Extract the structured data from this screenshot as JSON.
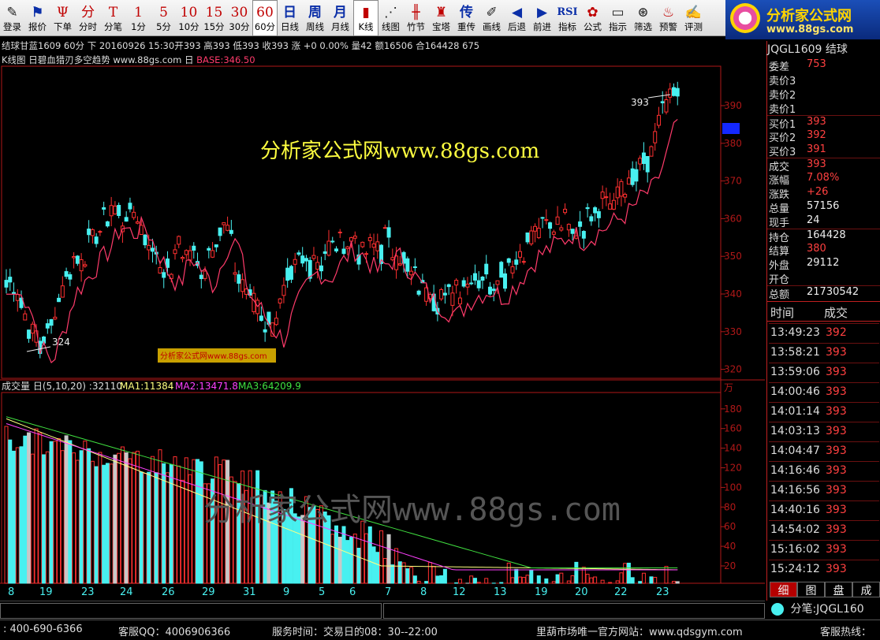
{
  "toolbar": [
    {
      "icon": "pencil-icon",
      "glyph": "✎",
      "label": "登录",
      "cls": "g"
    },
    {
      "icon": "quote-icon",
      "glyph": "⚑",
      "label": "报价",
      "cls": "b"
    },
    {
      "icon": "order-icon",
      "glyph": "Ψ",
      "label": "下单",
      "cls": ""
    },
    {
      "icon": "minute-icon",
      "glyph": "分",
      "label": "分时",
      "cls": ""
    },
    {
      "icon": "tick-icon",
      "glyph": "T",
      "label": "分笔",
      "cls": ""
    },
    {
      "icon": "1min-icon",
      "glyph": "1",
      "label": "1分",
      "cls": ""
    },
    {
      "icon": "5min-icon",
      "glyph": "5",
      "label": "5分",
      "cls": ""
    },
    {
      "icon": "10min-icon",
      "glyph": "10",
      "label": "10分",
      "cls": ""
    },
    {
      "icon": "15min-icon",
      "glyph": "15",
      "label": "15分",
      "cls": ""
    },
    {
      "icon": "30min-icon",
      "glyph": "30",
      "label": "30分",
      "cls": ""
    },
    {
      "icon": "60min-icon",
      "glyph": "60",
      "label": "60分",
      "cls": "",
      "on": true
    },
    {
      "icon": "day-icon",
      "glyph": "日",
      "label": "日线",
      "cls": "b"
    },
    {
      "icon": "week-icon",
      "glyph": "周",
      "label": "周线",
      "cls": "b"
    },
    {
      "icon": "month-icon",
      "glyph": "月",
      "label": "月线",
      "cls": "b"
    },
    {
      "icon": "kline-icon",
      "glyph": "▮",
      "label": "K线",
      "cls": "",
      "on": true
    },
    {
      "icon": "line-chart-icon",
      "glyph": "⋰",
      "label": "线图",
      "cls": "g"
    },
    {
      "icon": "bamboo-icon",
      "glyph": "╫",
      "label": "竹节",
      "cls": ""
    },
    {
      "icon": "tower-icon",
      "glyph": "♜",
      "label": "宝塔",
      "cls": ""
    },
    {
      "icon": "reload-icon",
      "glyph": "传",
      "label": "重传",
      "cls": "b"
    },
    {
      "icon": "draw-icon",
      "glyph": "✐",
      "label": "画线",
      "cls": "g"
    },
    {
      "icon": "back-icon",
      "glyph": "◀",
      "label": "后退",
      "cls": "b"
    },
    {
      "icon": "forward-icon",
      "glyph": "▶",
      "label": "前进",
      "cls": "b"
    },
    {
      "icon": "rsi-icon",
      "glyph": "RSI",
      "label": "指标",
      "cls": "b"
    },
    {
      "icon": "formula-icon",
      "glyph": "✿",
      "label": "公式",
      "cls": ""
    },
    {
      "icon": "indicator-icon",
      "glyph": "▭",
      "label": "指示",
      "cls": "g"
    },
    {
      "icon": "binoculars-icon",
      "glyph": "⊛",
      "label": "筛选",
      "cls": "g"
    },
    {
      "icon": "alarm-icon",
      "glyph": "♨",
      "label": "预警",
      "cls": ""
    },
    {
      "icon": "review-icon",
      "glyph": "✍",
      "label": "评测",
      "cls": "g"
    }
  ],
  "logo": {
    "title": "分析家公式网",
    "url": "www.88gs.com"
  },
  "header": {
    "info_line": "结球甘蓝1609 60分 下  20160926 15:30开393 高393 低393 收393 涨 +0 0.00% 量42 额16506 合164428 675",
    "chart_title": "K线图 日碧血猎刃多空趋势 www.88gs.com 日",
    "base_label": "BASE:346.50"
  },
  "watermark_main": "分析家公式网www.88gs.com",
  "watermark_small": "分析家公式网www.88gs.com",
  "watermark_volume": "分析家公式网www.88gs.com",
  "annot": {
    "high": "393",
    "low": "324"
  },
  "volume_header": {
    "name": "成交量 日(5,10,20) :32110",
    "ma1": "MA1:11384",
    "ma2": "MA2:13471.8",
    "ma3": "MA3:64209.9",
    "unit": "万"
  },
  "x_labels": [
    "8",
    "19",
    "23",
    "24",
    "26",
    "29",
    "31",
    "9",
    "5",
    "6",
    "7",
    "8",
    "12",
    "13",
    "19",
    "20",
    "22",
    "23"
  ],
  "price_axis": [
    "390",
    "380",
    "370",
    "360",
    "350",
    "340",
    "330",
    "320"
  ],
  "volume_axis": [
    "180",
    "160",
    "140",
    "120",
    "100",
    "80",
    "60",
    "40",
    "20"
  ],
  "side": {
    "code": "JQGL1609 结球",
    "rows": [
      {
        "k": "委差",
        "v": "753",
        "c": "red"
      },
      {
        "k": "卖价3",
        "v": "",
        "c": "wht"
      },
      {
        "k": "卖价2",
        "v": "",
        "c": "wht"
      },
      {
        "k": "卖价1",
        "v": "",
        "c": "wht"
      },
      {
        "k": "买价1",
        "v": "393",
        "c": "red"
      },
      {
        "k": "买价2",
        "v": "392",
        "c": "red"
      },
      {
        "k": "买价3",
        "v": "391",
        "c": "red"
      },
      {
        "k": "成交",
        "v": "393",
        "c": "red"
      },
      {
        "k": "涨幅",
        "v": "7.08%",
        "c": "red"
      },
      {
        "k": "涨跌",
        "v": "+26",
        "c": "red"
      },
      {
        "k": "总量",
        "v": "57156",
        "c": "wht"
      },
      {
        "k": "现手",
        "v": "24",
        "c": "wht"
      },
      {
        "k": "持仓",
        "v": "164428",
        "c": "wht"
      },
      {
        "k": "结算",
        "v": "380",
        "c": "red"
      },
      {
        "k": "外盘",
        "v": "29112",
        "c": "wht"
      },
      {
        "k": "开仓",
        "v": "",
        "c": "wht"
      },
      {
        "k": "总额",
        "v": "21730542",
        "c": "wht"
      }
    ],
    "trade_header": {
      "time": "时间",
      "vol": "成交"
    },
    "trades": [
      {
        "t": "13:49:23",
        "p": "392"
      },
      {
        "t": "13:58:21",
        "p": "393"
      },
      {
        "t": "13:59:06",
        "p": "393"
      },
      {
        "t": "14:00:46",
        "p": "393"
      },
      {
        "t": "14:01:14",
        "p": "393"
      },
      {
        "t": "14:03:13",
        "p": "393"
      },
      {
        "t": "14:04:47",
        "p": "393"
      },
      {
        "t": "14:16:46",
        "p": "393"
      },
      {
        "t": "14:16:56",
        "p": "393"
      },
      {
        "t": "14:40:16",
        "p": "393"
      },
      {
        "t": "14:54:02",
        "p": "393"
      },
      {
        "t": "15:16:02",
        "p": "393"
      },
      {
        "t": "15:24:12",
        "p": "393"
      }
    ],
    "tabs": [
      "细",
      "图",
      "盘",
      "成"
    ],
    "tick_label": "分笔:JQGL160"
  },
  "status": {
    "phone": ": 400-690-6366",
    "qq": "客服QQ：4006906366",
    "hours": "服务时间：交易日的08：30--22:00",
    "site": "里葫市场唯一官方网站：www.qdsgym.com",
    "hotline": "客服热线："
  },
  "colors": {
    "up": "#ff3030",
    "down": "#48f0f0",
    "ma_line": "#ff3b6b",
    "axis": "#b01818",
    "frame": "#b01818"
  }
}
